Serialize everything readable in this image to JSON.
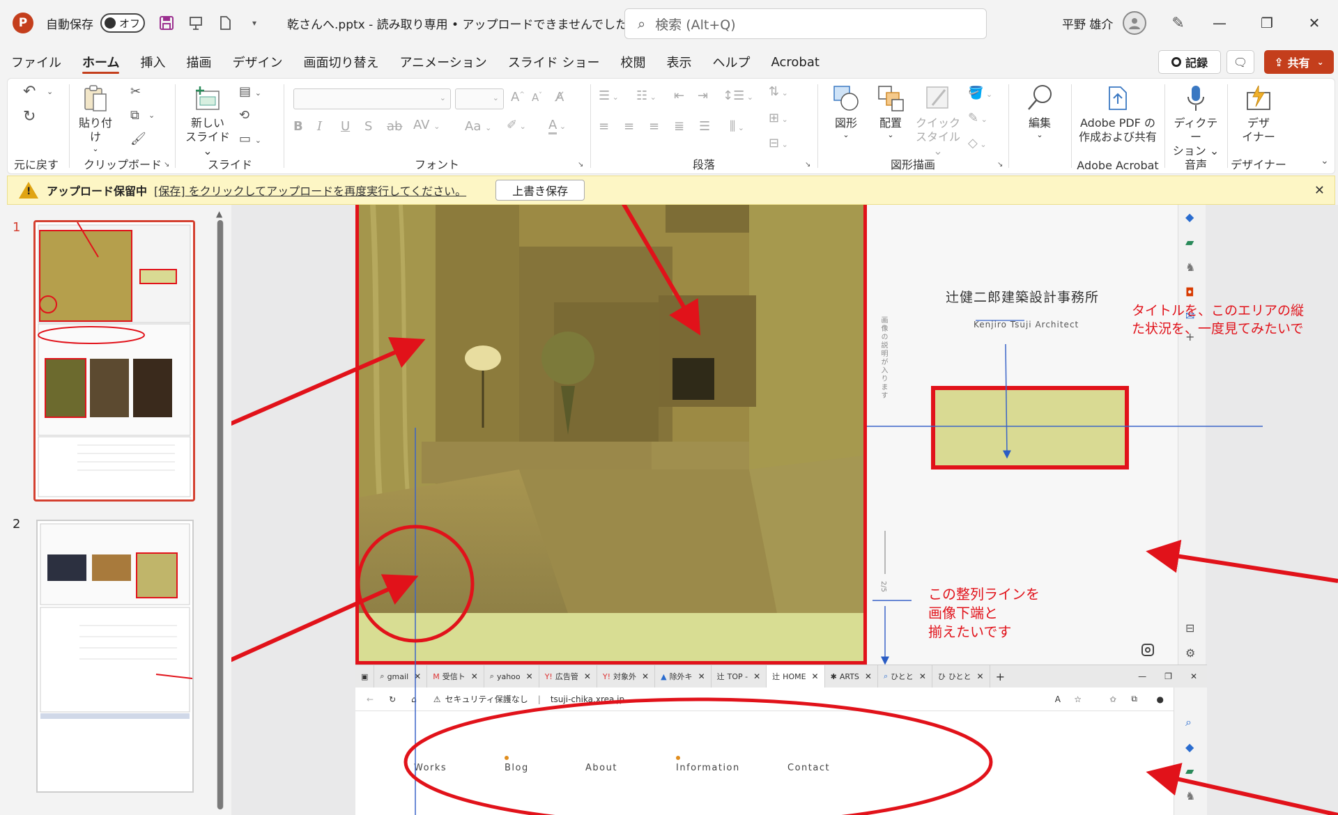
{
  "titlebar": {
    "app_logo": "P",
    "autosave_label": "自動保存",
    "autosave_state": "オフ",
    "doc_title": "乾さんへ.pptx  -  読み取り専用 • アップロードできませんでした",
    "search_placeholder": "検索 (Alt+Q)",
    "user_name": "平野 雄介"
  },
  "menu": {
    "tabs": [
      "ファイル",
      "ホーム",
      "挿入",
      "描画",
      "デザイン",
      "画面切り替え",
      "アニメーション",
      "スライド ショー",
      "校閲",
      "表示",
      "ヘルプ",
      "Acrobat"
    ],
    "active_tab": "ホーム",
    "record_label": "記録",
    "share_label": "共有"
  },
  "ribbon": {
    "undo_group": "元に戻す",
    "paste": "貼り付け",
    "clipboard_group": "クリップボード",
    "new_slide_line1": "新しい",
    "new_slide_line2": "スライド",
    "slides_group": "スライド",
    "font_group": "フォント",
    "font_aa": "Aa",
    "paragraph_group": "段落",
    "shapes": "図形",
    "arrange": "配置",
    "quick_style_line1": "クイック",
    "quick_style_line2": "スタイル",
    "drawing_group": "図形描画",
    "edit": "編集",
    "adobe_line1": "Adobe PDF の",
    "adobe_line2": "作成および共有",
    "adobe_group": "Adobe Acrobat",
    "dictate_line1": "ディクテー",
    "dictate_line2": "ション",
    "voice_group": "音声",
    "designer_line1": "デザ",
    "designer_line2": "イナー",
    "designer_group": "デザイナー"
  },
  "notification": {
    "title": "アップロード保留中",
    "message_link": "[保存] をクリックしてアップロードを再度実行してください。",
    "button": "上書き保存"
  },
  "thumbnails": {
    "slide_numbers": [
      "1",
      "2"
    ]
  },
  "slide": {
    "site_title": "辻健二郎建築設計事務所",
    "site_subtitle": "Kenjiro Tsuji Architect",
    "vertical_caption": "画像の説明が入ります",
    "pager": "2/5",
    "annotation_title": "タイトルを、このエリアの縦\nた状況を、一度見てみたいで",
    "annotation_align": "この整列ラインを\n画像下端と\n揃えたいです"
  },
  "browser": {
    "tabs": [
      "gmail",
      "受信ト",
      "yahoo",
      "広告管",
      "対象外",
      "除外キ",
      "TOP -",
      "HOME",
      "ARTS",
      "ひとと",
      "ひとと"
    ],
    "active_tab": "HOME",
    "security": "セキュリティ保護なし",
    "url": "tsuji-chika.xrea.jp",
    "nav": [
      "Works",
      "Blog",
      "About",
      "Information",
      "Contact"
    ]
  },
  "colors": {
    "accent": "#c43e1c",
    "annotation_red": "#e1121a",
    "highlight_fill": "#d9da93",
    "notification_bg": "#fdf6c5",
    "nav_dot": "#e08d1e"
  }
}
